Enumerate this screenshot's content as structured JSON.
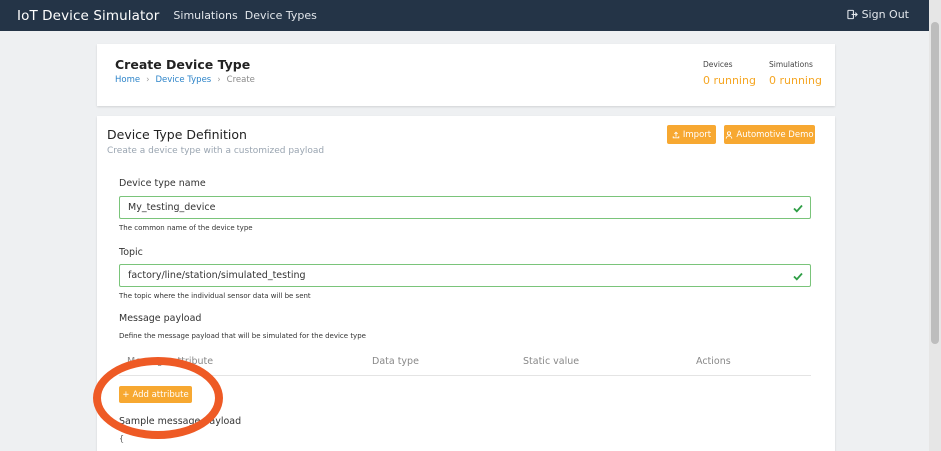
{
  "header": {
    "brand": "IoT Device Simulator",
    "nav": [
      "Simulations",
      "Device Types"
    ],
    "signout": "Sign Out"
  },
  "page": {
    "title": "Create Device Type",
    "breadcrumb": [
      "Home",
      "Device Types",
      "Create"
    ],
    "stats": [
      {
        "label": "Devices",
        "value": "0 running"
      },
      {
        "label": "Simulations",
        "value": "0 running"
      }
    ]
  },
  "definition": {
    "title": "Device Type Definition",
    "subtitle": "Create a device type with a customized payload",
    "import_label": "Import",
    "demo_label": "Automotive Demo",
    "name_label": "Device type name",
    "name_value": "My_testing_device",
    "name_help": "The common name of the device type",
    "topic_label": "Topic",
    "topic_value": "factory/line/station/simulated_testing",
    "topic_help": "The topic where the individual sensor data will be sent",
    "payload_label": "Message payload",
    "payload_help": "Define the message payload that will be simulated for the device type",
    "columns": [
      "Message attribute",
      "Data type",
      "Static value",
      "Actions"
    ],
    "add_label": "Add attribute",
    "sample_label": "Sample message payload",
    "sample_code": "{"
  },
  "colors": {
    "accent": "#f7a831",
    "topbar": "#243447",
    "valid": "#2e9e45",
    "annotation": "#ee5a25"
  }
}
